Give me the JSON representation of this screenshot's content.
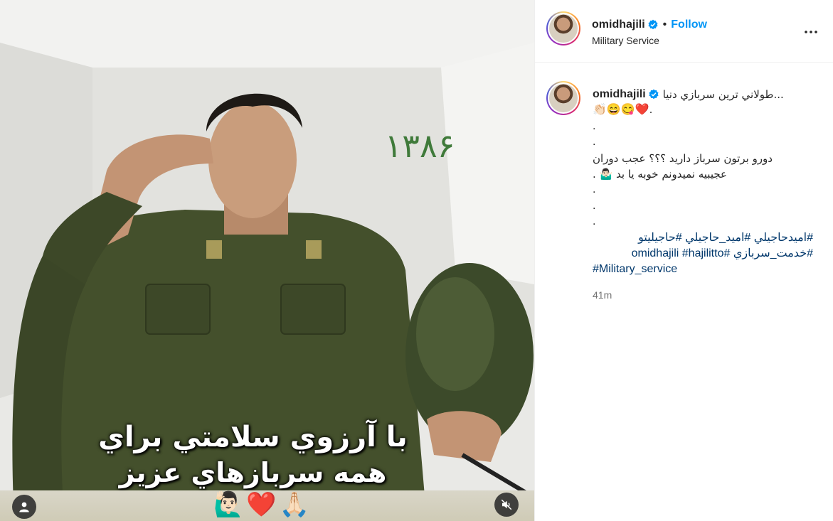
{
  "media": {
    "year_text": "۱۳۸۶",
    "overlay_line_1": "با آرزوي سلامتي براي",
    "overlay_line_2": "همه سربازهاي عزيز",
    "emoji_row": "🙋🏻‍♂️❤️🙏🏻"
  },
  "post_header": {
    "username": "omidhajili",
    "separator": "•",
    "follow_label": "Follow",
    "location": "Military Service"
  },
  "caption": {
    "username": "omidhajili",
    "title": "...طولاني ترين سربازي دنيا",
    "emojis": "👏🏻😄😋❤️.",
    "dot_1": ".",
    "dot_2": ".",
    "line_1": "دورو برتون سرباز داريد ؟؟؟ عجب دوران",
    "line_2": "عجيبيه نميدونم خوبه يا بد 🤷🏻‍♂️ .",
    "dot_3": ".",
    "dot_4": ".",
    "dot_5": ".",
    "hashtags_line_1": "#اميدحاجيلي #اميد_حاجيلي #حاجيليتو",
    "hashtags_line_2": "#خدمت_سربازي #omidhajili #hajilitto",
    "hashtags_line_3": "#Military_service",
    "timestamp": "41m"
  },
  "colors": {
    "follow_blue": "#0095f6",
    "hashtag_blue": "#00376b",
    "verified_blue": "#0095f6",
    "muted_gray": "#737373",
    "uniform_green": "#44502c"
  }
}
